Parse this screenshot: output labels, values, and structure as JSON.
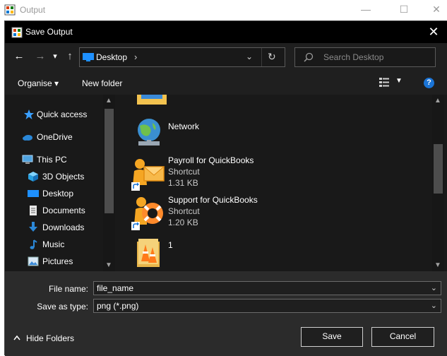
{
  "outer_window": {
    "title": "Output",
    "controls": {
      "minimize": "—",
      "maximize": "☐",
      "close": "✕"
    }
  },
  "dialog": {
    "title": "Save Output",
    "close": "✕"
  },
  "nav": {
    "back": "←",
    "forward": "→",
    "recent": "▾",
    "up": "↑",
    "address": "Desktop",
    "address_chevron": "›",
    "address_dropdown": "⌄",
    "refresh": "↻",
    "search_placeholder": "Search Desktop"
  },
  "toolbar": {
    "organise": "Organise ▾",
    "new_folder": "New folder",
    "view_dropdown": "▼",
    "help": "?"
  },
  "sidebar": {
    "items": [
      {
        "label": "Quick access",
        "icon": "star-icon"
      },
      {
        "label": "OneDrive",
        "icon": "cloud-icon"
      },
      {
        "label": "This PC",
        "icon": "computer-icon"
      },
      {
        "label": "3D Objects",
        "icon": "cube-icon"
      },
      {
        "label": "Desktop",
        "icon": "desktop-icon"
      },
      {
        "label": "Documents",
        "icon": "document-icon"
      },
      {
        "label": "Downloads",
        "icon": "download-icon"
      },
      {
        "label": "Music",
        "icon": "music-icon"
      },
      {
        "label": "Pictures",
        "icon": "pictures-icon"
      }
    ]
  },
  "files": [
    {
      "name": "Network",
      "type": "",
      "size": "",
      "icon": "network-icon"
    },
    {
      "name": "Payroll for QuickBooks",
      "type": "Shortcut",
      "size": "1.31 KB",
      "icon": "payroll-shortcut-icon"
    },
    {
      "name": "Support for QuickBooks",
      "type": "Shortcut",
      "size": "1.20 KB",
      "icon": "support-shortcut-icon"
    },
    {
      "name": "1",
      "type": "",
      "size": "",
      "icon": "folder-icon"
    }
  ],
  "bottom": {
    "file_name_label": "File name:",
    "file_name_value": "file_name",
    "save_type_label": "Save as type:",
    "save_type_value": "png (*.png)",
    "combo_arrow": "⌄",
    "hide_folders": "Hide Folders",
    "save": "Save",
    "cancel": "Cancel"
  },
  "colors": {
    "dialog_bg": "#1f1f1f",
    "titlebar_bg": "#000000",
    "content_bg": "#191919",
    "bottom_bg": "#2b2b2b",
    "accent": "#1a74d6"
  }
}
